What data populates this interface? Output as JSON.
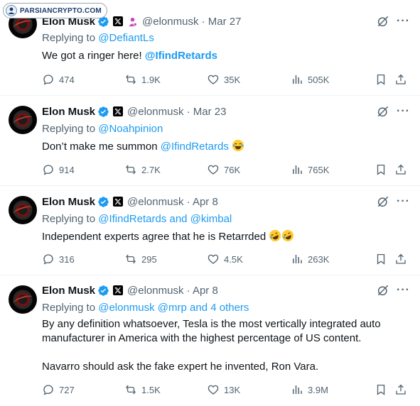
{
  "watermark": {
    "text": "PARSIANCRYPTO.COM"
  },
  "tweets": [
    {
      "name": "Elon Musk",
      "handle_date": "@elonmusk · Mar 27",
      "replying_prefix": "Replying to ",
      "replying_to": "@DefiantLs",
      "text_plain": "We got a ringer here! ",
      "text_mention": "@IfindRetards",
      "metrics": {
        "replies": "474",
        "retweets": "1.9K",
        "likes": "35K",
        "views": "505K"
      }
    },
    {
      "name": "Elon Musk",
      "handle_date": "@elonmusk · Mar 23",
      "replying_prefix": "Replying to ",
      "replying_to": "@Noahpinion",
      "text_plain": "Don’t make me summon ",
      "text_mention": "@IfindRetards",
      "metrics": {
        "replies": "914",
        "retweets": "2.7K",
        "likes": "76K",
        "views": "765K"
      }
    },
    {
      "name": "Elon Musk",
      "handle_date": "@elonmusk · Apr 8",
      "replying_prefix": "Replying to ",
      "replying_to": "@IfindRetards and @kimbal",
      "text_plain": "Independent experts agree that he is Retarrded ",
      "metrics": {
        "replies": "316",
        "retweets": "295",
        "likes": "4.5K",
        "views": "263K"
      }
    },
    {
      "name": "Elon Musk",
      "handle_date": "@elonmusk · Apr 8",
      "replying_prefix": "Replying to ",
      "replying_to": "@elonmusk @mrp and 4 others",
      "text_line1": "By any definition whatsoever, Tesla is the most vertically integrated auto",
      "text_line2": "manufacturer in America with the highest percentage of US content.",
      "text_line3": "Navarro should ask the fake expert he invented, Ron Vara.",
      "metrics": {
        "replies": "727",
        "retweets": "1.5K",
        "likes": "13K",
        "views": "3.9M"
      }
    }
  ],
  "icons": {
    "verified": "verified-badge-icon",
    "x": "x-logo-icon",
    "affiliate": "affiliate-badge-icon",
    "grok": "grok-icon",
    "more": "more-icon",
    "reply": "reply-icon",
    "retweet": "retweet-icon",
    "like": "heart-icon",
    "views": "views-icon",
    "bookmark": "bookmark-icon",
    "share": "share-icon"
  },
  "colors": {
    "link": "#1d9bf0",
    "muted": "#536471",
    "text": "#0f1419",
    "verified": "#1d9bf0"
  }
}
